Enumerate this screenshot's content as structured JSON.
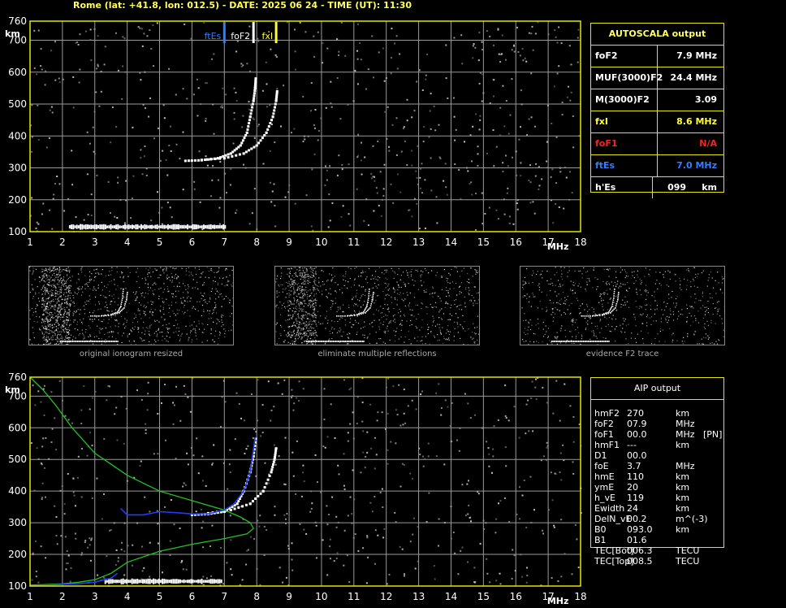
{
  "header": {
    "title": "Rome (lat: +41.8, lon: 012.5) - DATE: 2025 06 24 - TIME (UT): 11:30"
  },
  "colors": {
    "frame": "#e6e600",
    "grid": "#9a9a9a",
    "noise": "#cfcfcf",
    "trace": "#ffffff",
    "fte": "#2f7fff",
    "fof2": "#ffffff",
    "fxl": "#ffff33",
    "fof1": "#ff2020",
    "profile": "#22c222",
    "fit": "#1f3cff"
  },
  "chart_data": [
    {
      "type": "scatter",
      "name": "ionogram-autoscala",
      "xlabel": "MHz",
      "ylabel": "km",
      "xlim": [
        1,
        18
      ],
      "ylim": [
        100,
        760
      ],
      "xticks": [
        "1",
        "2",
        "3",
        "4",
        "5",
        "6",
        "7",
        "8",
        "9",
        "10",
        "11",
        "12",
        "13",
        "14",
        "15",
        "16",
        "17",
        "18"
      ],
      "yticks": [
        "100",
        "200",
        "300",
        "400",
        "500",
        "600",
        "700",
        "760"
      ],
      "grid": true,
      "markers": [
        {
          "label": "ftEs",
          "x": 7.0,
          "color": "#2f7fff"
        },
        {
          "label": "foF2",
          "x": 7.9,
          "color": "#ffffff"
        },
        {
          "label": "fxI",
          "x": 8.6,
          "color": "#ffff33"
        }
      ],
      "es_trace": {
        "x_from": 2.2,
        "x_to": 7.0,
        "h": 115
      },
      "o_trace": [
        [
          5.8,
          322
        ],
        [
          6.3,
          324
        ],
        [
          6.8,
          330
        ],
        [
          7.2,
          345
        ],
        [
          7.5,
          370
        ],
        [
          7.7,
          410
        ],
        [
          7.8,
          460
        ],
        [
          7.9,
          510
        ],
        [
          7.95,
          550
        ],
        [
          7.97,
          580
        ]
      ],
      "x_trace": [
        [
          6.3,
          325
        ],
        [
          7.0,
          330
        ],
        [
          7.6,
          345
        ],
        [
          8.0,
          370
        ],
        [
          8.3,
          410
        ],
        [
          8.5,
          460
        ],
        [
          8.6,
          510
        ],
        [
          8.63,
          540
        ]
      ]
    },
    {
      "type": "line",
      "name": "ionogram-aip",
      "xlabel": "MHz",
      "ylabel": "km",
      "xlim": [
        1,
        18
      ],
      "ylim": [
        100,
        760
      ],
      "xticks": [
        "1",
        "2",
        "3",
        "4",
        "5",
        "6",
        "7",
        "8",
        "9",
        "10",
        "11",
        "12",
        "13",
        "14",
        "15",
        "16",
        "17",
        "18"
      ],
      "yticks": [
        "100",
        "200",
        "300",
        "400",
        "500",
        "600",
        "700",
        "760"
      ],
      "grid": true,
      "series": [
        {
          "x": [
            1.0,
            1.4,
            1.8,
            2.3,
            3.0,
            4.0,
            5.0,
            6.0,
            7.0,
            7.5,
            7.8,
            7.9,
            7.7,
            7.0,
            6.0,
            5.0,
            4.0,
            3.5,
            3.0,
            2.5,
            2.0,
            1.5,
            1.0
          ],
          "y": [
            760,
            720,
            670,
            600,
            520,
            450,
            400,
            370,
            340,
            318,
            300,
            282,
            265,
            250,
            232,
            210,
            175,
            140,
            120,
            112,
            107,
            105,
            103
          ]
        },
        {
          "x": [
            3.8,
            4.0,
            4.5,
            5.0,
            5.5,
            6.0,
            6.5,
            7.0,
            7.3,
            7.6,
            7.8,
            7.95
          ],
          "y": [
            345,
            325,
            325,
            335,
            332,
            328,
            328,
            340,
            360,
            400,
            460,
            570
          ]
        },
        {
          "x": [
            1.0,
            1.5,
            2.0,
            2.5,
            3.0,
            3.5,
            3.7
          ],
          "y": [
            100,
            102,
            105,
            108,
            112,
            125,
            140
          ]
        }
      ],
      "es_trace": {
        "x_from": 3.3,
        "x_to": 6.9,
        "h": 115
      },
      "o_trace": [
        [
          6.0,
          325
        ],
        [
          6.5,
          328
        ],
        [
          7.0,
          335
        ],
        [
          7.4,
          360
        ],
        [
          7.6,
          400
        ],
        [
          7.8,
          460
        ],
        [
          7.9,
          510
        ],
        [
          7.97,
          565
        ]
      ],
      "x_trace": [
        [
          6.5,
          330
        ],
        [
          7.2,
          340
        ],
        [
          7.8,
          360
        ],
        [
          8.2,
          400
        ],
        [
          8.45,
          460
        ],
        [
          8.55,
          500
        ],
        [
          8.6,
          535
        ]
      ]
    }
  ],
  "thumbnails": [
    {
      "caption": "original ionogram resized"
    },
    {
      "caption": "eliminate multiple reflections"
    },
    {
      "caption": "evidence F2 trace"
    }
  ],
  "autoscala": {
    "title": "AUTOSCALA output",
    "rows": [
      {
        "label": "foF2",
        "value": "7.9 MHz",
        "color": "#ffffff"
      },
      {
        "label": "MUF(3000)F2",
        "value": "24.4 MHz",
        "color": "#ffffff"
      },
      {
        "label": "M(3000)F2",
        "value": "3.09",
        "color": "#ffffff"
      },
      {
        "label": "fxI",
        "value": "8.6 MHz",
        "color": "#ffff33"
      },
      {
        "label": "foF1",
        "value": "N/A",
        "color": "#ff2020"
      },
      {
        "label": "ftEs",
        "value": "7.0 MHz",
        "color": "#2f7fff"
      },
      {
        "label": "h'Es",
        "value": "099     km",
        "color": "#ffffff"
      }
    ]
  },
  "aip": {
    "title": "AIP output",
    "rows": [
      {
        "label": "hmF2",
        "value": "270",
        "unit": "km",
        "extra": ""
      },
      {
        "label": "foF2",
        "value": "07.9",
        "unit": "MHz",
        "extra": ""
      },
      {
        "label": "foF1",
        "value": "00.0",
        "unit": "MHz",
        "extra": "[PN]"
      },
      {
        "label": "hmF1",
        "value": "---",
        "unit": "km",
        "extra": ""
      },
      {
        "label": "D1",
        "value": "00.0",
        "unit": "",
        "extra": ""
      },
      {
        "label": "foE",
        "value": "3.7",
        "unit": "MHz",
        "extra": ""
      },
      {
        "label": "hmE",
        "value": "110",
        "unit": "km",
        "extra": ""
      },
      {
        "label": "ymE",
        "value": "20",
        "unit": "km",
        "extra": ""
      },
      {
        "label": "h_vE",
        "value": "119",
        "unit": "km",
        "extra": ""
      },
      {
        "label": "Ewidth",
        "value": "24",
        "unit": "km",
        "extra": ""
      },
      {
        "label": "DelN_vE",
        "value": "00.2",
        "unit": "m^(-3)",
        "extra": ""
      },
      {
        "label": "B0",
        "value": "093.0",
        "unit": "km",
        "extra": ""
      },
      {
        "label": "B1",
        "value": "01.6",
        "unit": "",
        "extra": ""
      },
      {
        "label": "TEC[Bot]",
        "value": "006.3",
        "unit": "TECU",
        "extra": ""
      },
      {
        "label": "TEC[Top]",
        "value": "008.5",
        "unit": "TECU",
        "extra": ""
      }
    ]
  }
}
